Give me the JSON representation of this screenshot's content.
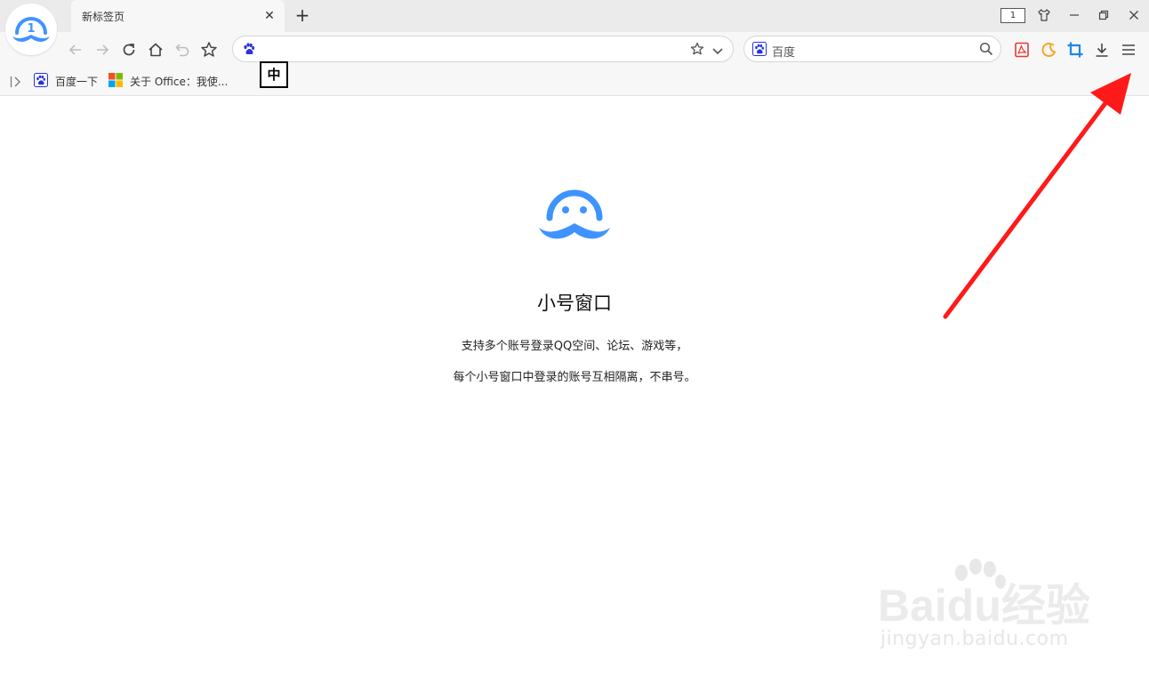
{
  "window": {
    "tab_title": "新标签页",
    "tab_close": "✕",
    "new_tab": "+",
    "window_count": "1"
  },
  "address_bar": {
    "value": ""
  },
  "search_bar": {
    "placeholder": "百度"
  },
  "bookmarks": {
    "items": [
      {
        "label": "百度一下",
        "icon": "baidu-paw-icon"
      },
      {
        "label": "关于 Office：我使...",
        "icon": "microsoft-logo-icon"
      }
    ]
  },
  "ime": {
    "label": "中"
  },
  "page": {
    "title": "小号窗口",
    "line1": "支持多个账号登录QQ空间、论坛、游戏等，",
    "line2": "每个小号窗口中登录的账号互相隔离，不串号。"
  },
  "watermark": {
    "brand": "Baidu经验",
    "url": "jingyan.baidu.com"
  },
  "colors": {
    "accent_blue": "#3f93ff",
    "annotation_red": "#ff1a1a",
    "pdf_red": "#e53935",
    "crop_blue": "#1e88e5",
    "moon_orange": "#f5a623"
  }
}
